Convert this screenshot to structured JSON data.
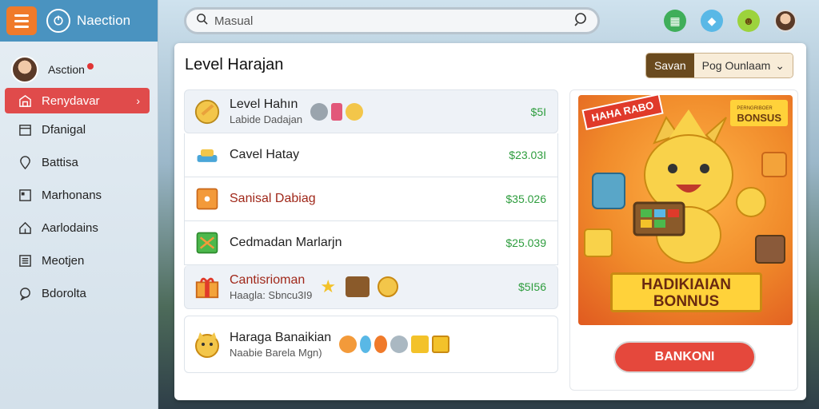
{
  "sidebar": {
    "app_name": "Naection",
    "user_name": "Asction",
    "items": [
      {
        "label": "Renydavar",
        "icon": "store-icon",
        "active": true
      },
      {
        "label": "Dfanigal",
        "icon": "calendar-icon",
        "active": false
      },
      {
        "label": "Battisa",
        "icon": "map-pin-icon",
        "active": false
      },
      {
        "label": "Marhonans",
        "icon": "document-icon",
        "active": false
      },
      {
        "label": "Aarlodains",
        "icon": "home-icon",
        "active": false
      },
      {
        "label": "Meotjen",
        "icon": "list-icon",
        "active": false
      },
      {
        "label": "Bdorolta",
        "icon": "chat-icon",
        "active": false
      }
    ]
  },
  "search": {
    "placeholder": "Masual"
  },
  "panel": {
    "title": "Level Harajan",
    "save_label": "Savan",
    "select_label": "Pog Ounlaam",
    "rows": [
      {
        "title": "Level Hahın",
        "subtitle": "Labide Dadajan",
        "price": "$5I"
      },
      {
        "title": "Cavel Hatay",
        "subtitle": "",
        "price": "$23.03I"
      },
      {
        "title": "Sanisal Dabiag",
        "subtitle": "",
        "price": "$35.026"
      },
      {
        "title": "Cedmadan Marlarjn",
        "subtitle": "",
        "price": "$25.039"
      },
      {
        "title": "Cantisrioman",
        "subtitle": "Haagla: Sbncu3I9",
        "price": "$5I56"
      },
      {
        "title": "Haraga Banaikian",
        "subtitle": "Naabie Barela Mgn)",
        "price": ""
      }
    ]
  },
  "promo": {
    "ribbon": "HAHA RABO",
    "bonus_tag_small": "PERNGRIBOER",
    "bonus_tag": "BONSUS",
    "banner": "HADIKIAIAN BONNUS",
    "cta_label": "BANKONI"
  },
  "colors": {
    "accent_red": "#e04b4b",
    "header_blue": "#4a93c0",
    "price_green": "#2e9d3e"
  }
}
